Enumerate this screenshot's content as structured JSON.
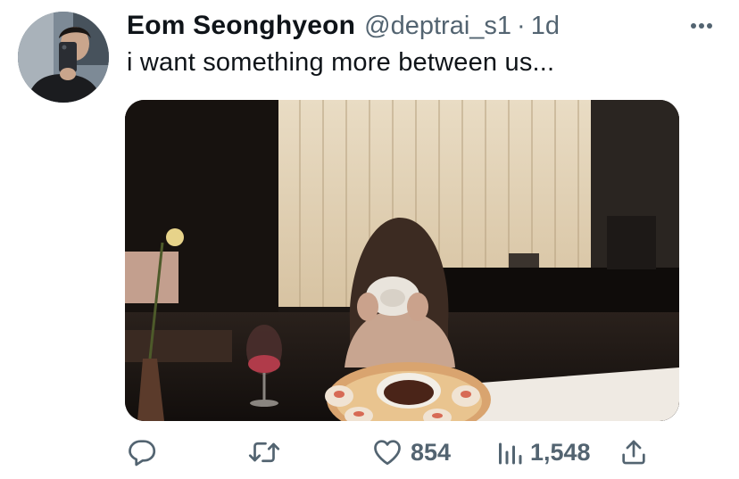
{
  "author": {
    "display_name": "Eom Seonghyeon",
    "handle": "@deptrai_s1",
    "separator": "·",
    "time": "1d"
  },
  "tweet": {
    "text": "i want something more between us..."
  },
  "icons": {
    "more": "more-horizontal-icon",
    "reply": "reply-icon",
    "retweet": "retweet-icon",
    "like": "heart-icon",
    "views": "views-icon",
    "share": "share-icon"
  },
  "actions": {
    "likes": "854",
    "views": "1,548"
  },
  "colors": {
    "text_primary": "#0f1419",
    "text_secondary": "#536471",
    "background": "#ffffff"
  }
}
